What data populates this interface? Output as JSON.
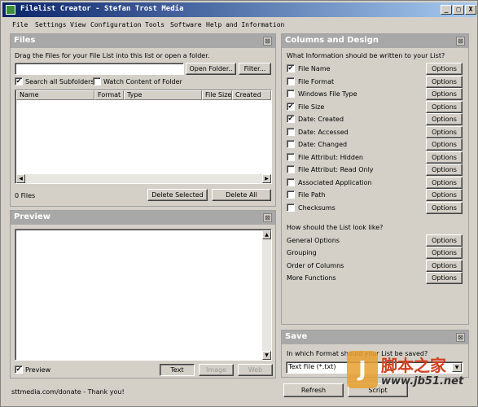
{
  "window": {
    "title": "Filelist Creator - Stefan Trost Media",
    "min_glyph": "_",
    "max_glyph": "□",
    "close_glyph": "X"
  },
  "menu": {
    "items": [
      "File",
      "Settings",
      "View",
      "Configuration",
      "Tools",
      "Software",
      "Help and Information"
    ]
  },
  "files_panel": {
    "title": "Files",
    "close_glyph": "⊠",
    "instruction": "Drag the Files for your File List into this list or open a folder.",
    "path_value": "",
    "open_folder_label": "Open Folder..",
    "filter_label": "Filter...",
    "search_subfolders_label": "Search all Subfolders",
    "search_subfolders_checked": true,
    "watch_content_label": "Watch Content of Folder",
    "watch_content_checked": false,
    "columns": [
      "Name",
      "Format",
      "Type",
      "File Size",
      "Created"
    ],
    "count_text": "0 Files",
    "delete_selected_label": "Delete Selected",
    "delete_all_label": "Delete All"
  },
  "preview_panel": {
    "title": "Preview",
    "close_glyph": "⊠",
    "preview_label": "Preview",
    "preview_checked": true,
    "text_label": "Text",
    "image_label": "Image",
    "web_label": "Web"
  },
  "columns_panel": {
    "title": "Columns and Design",
    "close_glyph": "⊠",
    "question": "What Information should be written to your List?",
    "options_label": "Options",
    "fields": [
      {
        "label": "File Name",
        "checked": true
      },
      {
        "label": "File Format",
        "checked": false
      },
      {
        "label": "Windows File Type",
        "checked": false
      },
      {
        "label": "File Size",
        "checked": true
      },
      {
        "label": "Date: Created",
        "checked": true
      },
      {
        "label": "Date: Accessed",
        "checked": false
      },
      {
        "label": "Date: Changed",
        "checked": false
      },
      {
        "label": "File Attribut: Hidden",
        "checked": false
      },
      {
        "label": "File Attribut: Read Only",
        "checked": false
      },
      {
        "label": "Associated Application",
        "checked": false
      },
      {
        "label": "File Path",
        "checked": false
      },
      {
        "label": "Checksums",
        "checked": false
      }
    ],
    "look_question": "How should the List look like?",
    "look_items": [
      "General Options",
      "Grouping",
      "Order of Columns",
      "More Functions"
    ]
  },
  "save_panel": {
    "title": "Save",
    "close_glyph": "⊠",
    "question": "In which Format should your List be saved?",
    "format_value": "Text File (*.txt)",
    "dropdown_glyph": "▼"
  },
  "footer": {
    "donate_text": "sttmedia.com/donate - Thank you!",
    "refresh_label": "Refresh",
    "script_label": "Script"
  },
  "watermark": {
    "text": "脚本之家",
    "domain": "www.jb51.net"
  },
  "colors": {
    "title_start": "#0a246a",
    "title_end": "#a6caf0",
    "panel_header": "#a8a8a8",
    "face": "#d4d0c8"
  }
}
